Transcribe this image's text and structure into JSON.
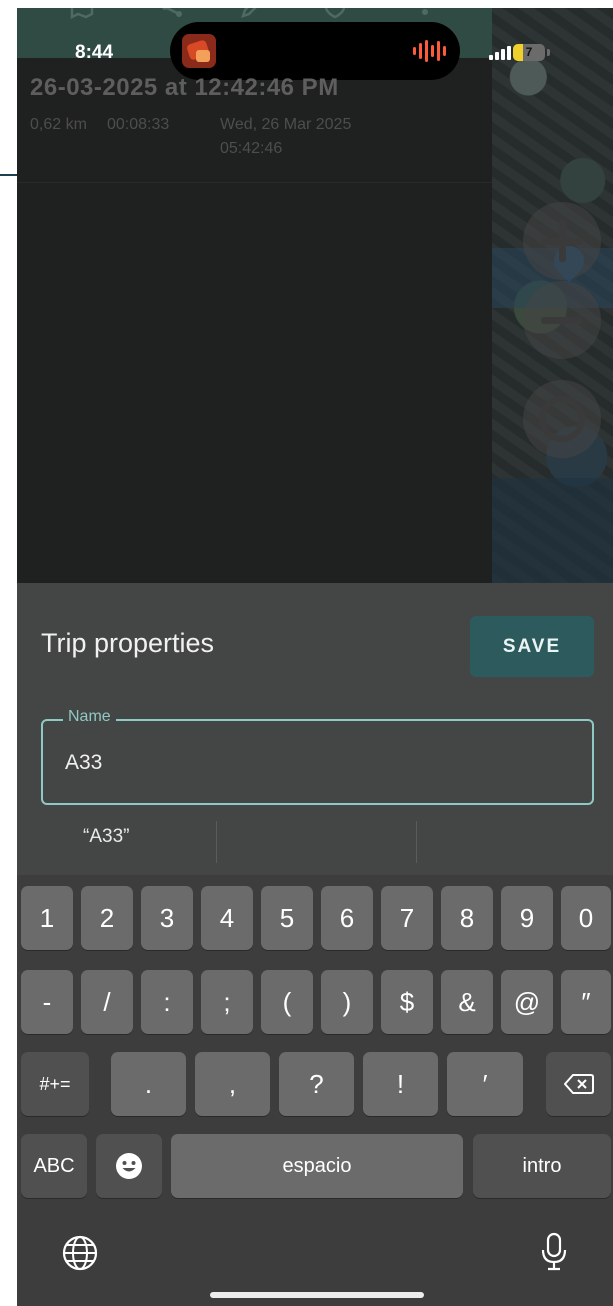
{
  "status_bar": {
    "time": "8:44",
    "battery": "7"
  },
  "trip": {
    "title": "26-03-2025 at 12:42:46 PM",
    "distance": "0,62 km",
    "duration": "00:08:33",
    "date_line1": "Wed, 26 Mar 2025",
    "date_line2": "05:42:46"
  },
  "sheet": {
    "title": "Trip properties",
    "save_label": "SAVE",
    "name_label": "Name",
    "name_value": "A33",
    "suggestion": "“A33”"
  },
  "keyboard": {
    "row1": [
      "1",
      "2",
      "3",
      "4",
      "5",
      "6",
      "7",
      "8",
      "9",
      "0"
    ],
    "row2": [
      "-",
      "/",
      ":",
      ";",
      "(",
      ")",
      "$",
      "&",
      "@",
      "″"
    ],
    "row3_shift": "#+=",
    "row3": [
      ".",
      ",",
      "?",
      "!",
      "′"
    ],
    "abc": "ABC",
    "space": "espacio",
    "return": "intro"
  },
  "icons": [
    "map-icon",
    "share-icon",
    "edit-icon",
    "shield-icon",
    "more-icon",
    "zoom-in-icon",
    "zoom-out-icon",
    "locate-icon",
    "emoji-icon",
    "globe-icon",
    "mic-icon",
    "backspace-icon"
  ]
}
